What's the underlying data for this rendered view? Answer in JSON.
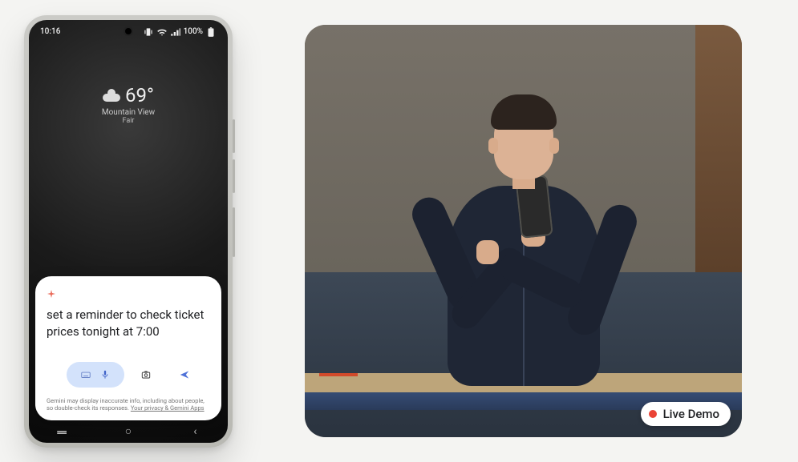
{
  "phone": {
    "status": {
      "time": "10:16",
      "battery": "100%"
    },
    "weather": {
      "temp": "69°",
      "location": "Mountain View",
      "condition": "Fair"
    },
    "assistant": {
      "prompt": "set a reminder to check ticket prices tonight at 7:00",
      "disclaimer_a": "Gemini may display inaccurate info, including about people, so double-check its responses. ",
      "disclaimer_link": "Your privacy & Gemini Apps"
    },
    "nav": {
      "recents": "|||",
      "home": "○",
      "back": "‹"
    }
  },
  "video": {
    "badge": "Live Demo"
  }
}
